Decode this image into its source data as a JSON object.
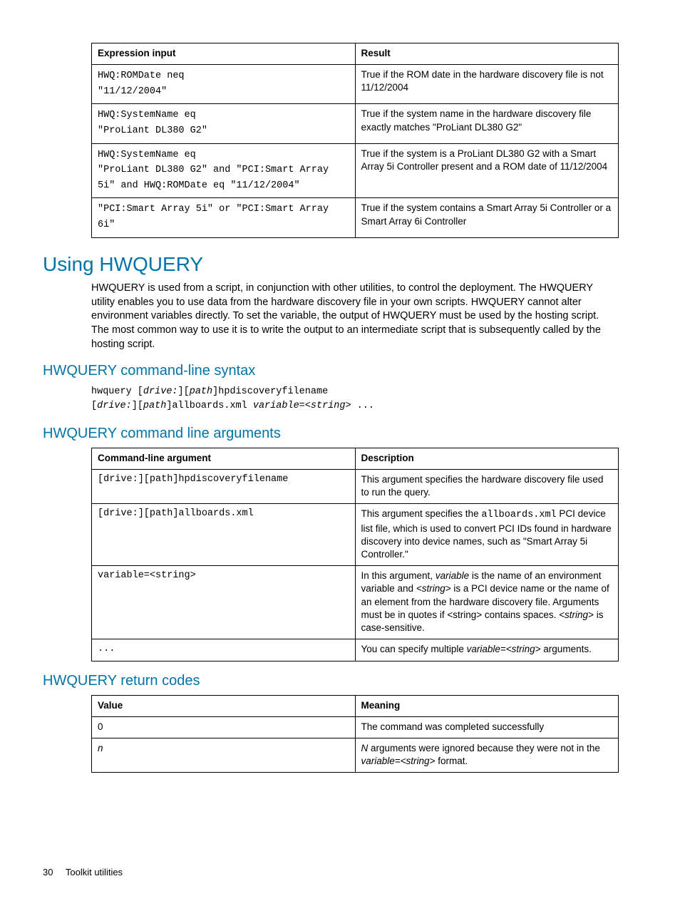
{
  "tables": {
    "expr": {
      "headers": [
        "Expression input",
        "Result"
      ],
      "rows": [
        {
          "input_lines": [
            "HWQ:ROMDate neq",
            "\"11/12/2004\""
          ],
          "result": "True if the ROM date in the hardware discovery file is not 11/12/2004"
        },
        {
          "input_lines": [
            "HWQ:SystemName eq",
            "\"ProLiant DL380 G2\""
          ],
          "result": "True if the system name in the hardware discovery file exactly matches \"ProLiant DL380 G2\""
        },
        {
          "input_lines": [
            "HWQ:SystemName eq",
            "\"ProLiant DL380 G2\" and \"PCI:Smart Array 5i\" and HWQ:ROMDate eq \"11/12/2004\""
          ],
          "result": "True if the system is a ProLiant DL380 G2 with a Smart Array 5i Controller present and a ROM date of 11/12/2004"
        },
        {
          "input_lines": [
            "\"PCI:Smart Array 5i\" or \"PCI:Smart Array 6i\""
          ],
          "result": "True if the system contains a Smart Array 5i Controller or a Smart Array 6i Controller"
        }
      ]
    },
    "args": {
      "headers": [
        "Command-line argument",
        "Description"
      ],
      "rows": [
        {
          "arg": "[drive:][path]hpdiscoveryfilename",
          "desc_plain": "This argument specifies the hardware discovery file used to run the query."
        },
        {
          "arg": "[drive:][path]allboards.xml",
          "desc_pre": "This argument specifies the ",
          "desc_mono": "allboards.xml",
          "desc_post": " PCI device list file, which is used to convert PCI IDs found in hardware discovery into device names, such as \"Smart Array 5i Controller.\""
        },
        {
          "arg": "variable=<string>",
          "desc_html": "In this argument, <i>variable</i> is the name of an environment variable and <i>&lt;string&gt;</i> is a PCI device name or the name of an element from the hardware discovery file. Arguments must be in quotes if &lt;string&gt; contains spaces. <i>&lt;string&gt;</i> is case-sensitive."
        },
        {
          "arg": "...",
          "desc_html": "You can specify multiple <i>variable=&lt;string&gt;</i> arguments."
        }
      ]
    },
    "ret": {
      "headers": [
        "Value",
        "Meaning"
      ],
      "rows": [
        {
          "value": "0",
          "value_italic": false,
          "meaning": "The command was completed successfully"
        },
        {
          "value": "n",
          "value_italic": true,
          "meaning_html": "<i>N</i> arguments were ignored because they were not in the <i>variable=&lt;string&gt;</i> format."
        }
      ]
    }
  },
  "headings": {
    "h1": "Using HWQUERY",
    "h2_syntax": "HWQUERY command-line syntax",
    "h2_args": "HWQUERY command line arguments",
    "h2_ret": "HWQUERY return codes"
  },
  "paragraphs": {
    "intro": "HWQUERY is used from a script, in conjunction with other utilities, to control the deployment. The HWQUERY utility enables you to use data from the hardware discovery file in your own scripts. HWQUERY cannot alter environment variables directly. To set the variable, the output of HWQUERY must be used by the hosting script. The most common way to use it is to write the output to an intermediate script that is subsequently called by the hosting script."
  },
  "syntax": {
    "line1_pre": "hwquery [",
    "line1_it1": "drive:",
    "line1_mid": "][",
    "line1_it2": "path",
    "line1_post": "]hpdiscoveryfilename",
    "line2_pre": "[",
    "line2_it1": "drive:",
    "line2_mid": "][",
    "line2_it2": "path",
    "line2_post1": "]allboards.xml ",
    "line2_it3": "variable",
    "line2_eq": "=<",
    "line2_it4": "string",
    "line2_post2": "> ..."
  },
  "footer": {
    "page": "30",
    "section": "Toolkit utilities"
  }
}
